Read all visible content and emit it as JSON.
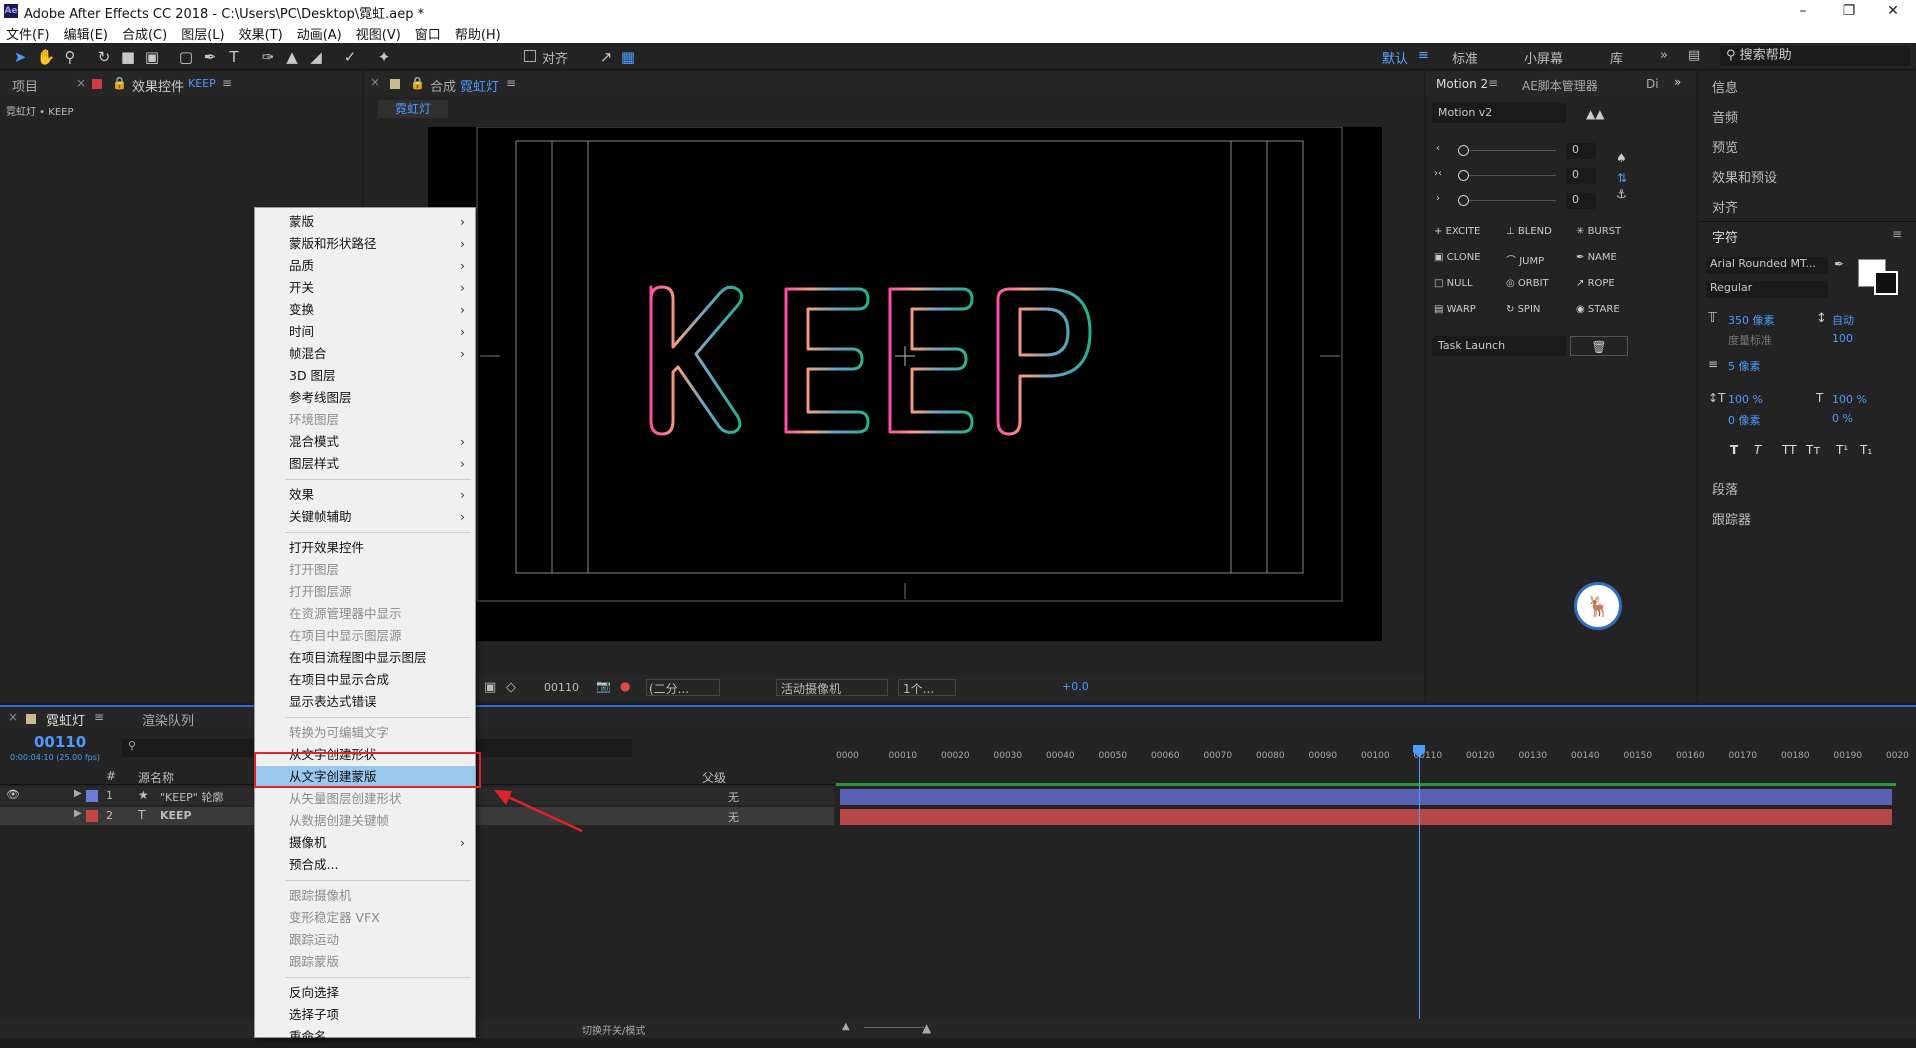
{
  "title": {
    "app_icon": "Ae",
    "text": "Adobe After Effects CC 2018 - C:\\Users\\PC\\Desktop\\霓虹.aep *"
  },
  "menu": [
    "文件(F)",
    "编辑(E)",
    "合成(C)",
    "图层(L)",
    "效果(T)",
    "动画(A)",
    "视图(V)",
    "窗口",
    "帮助(H)"
  ],
  "toolbar": {
    "snap_label": "对齐",
    "workspaces": [
      "默认",
      "标准",
      "小屏幕",
      "库"
    ],
    "search_placeholder": "搜索帮助",
    "more": "»"
  },
  "left_panel": {
    "tab_project": "项目",
    "tab_effects": "效果控件",
    "tab_effects_layer": "KEEP",
    "breadcrumb": "霓虹灯 • KEEP"
  },
  "comp_panel": {
    "tab_prefix": "合成",
    "tab_name": "霓虹灯",
    "subtab": "霓虹灯",
    "neon_text": [
      "K",
      "E",
      "E",
      "P"
    ],
    "timecode": "00110",
    "resolution": "(二分...",
    "camera": "活动摄像机",
    "views": "1个...",
    "exposure": "+0.0"
  },
  "motion_panel": {
    "tab": "Motion 2",
    "tab2": "AE脚本管理器",
    "tab3": "Di",
    "preset": "Motion v2",
    "slider_values": [
      "0",
      "0",
      "0"
    ],
    "buttons": [
      "EXCITE",
      "BLEND",
      "BURST",
      "CLONE",
      "JUMP",
      "NAME",
      "NULL",
      "ORBIT",
      "ROPE",
      "WARP",
      "SPIN",
      "STARE"
    ],
    "launch": "Task Launch"
  },
  "right_panel": {
    "items_top": [
      "信息",
      "音频",
      "预览",
      "效果和预设",
      "对齐"
    ],
    "char_title": "字符",
    "font": "Arial Rounded MT...",
    "style": "Regular",
    "size": "350 像素",
    "leading": "自动",
    "kerning": "度量标准",
    "tracking": "100",
    "stroke": "5 像素",
    "vscale": "100 %",
    "hscale": "100 %",
    "baseline": "0 像素",
    "tsume": "0 %",
    "style_buttons": [
      "T",
      "T",
      "TT",
      "Tт",
      "T¹",
      "T₁"
    ],
    "items_bottom": [
      "段落",
      "跟踪器"
    ]
  },
  "timeline": {
    "tab": "霓虹灯",
    "tab2": "渲染队列",
    "timecode": "00110",
    "fps": "0:00:04:10 (25.00 fps)",
    "col_name": "源名称",
    "col_parent": "父级",
    "col_num": "#",
    "layers": [
      {
        "num": "1",
        "icon": "★",
        "name": "\"KEEP\" 轮廓",
        "color": "#6f79d9",
        "parent": "无"
      },
      {
        "num": "2",
        "icon": "T",
        "name": "KEEP",
        "color": "#c64545",
        "parent": "无"
      }
    ],
    "ruler": [
      "0000",
      "00010",
      "00020",
      "00030",
      "00040",
      "00050",
      "00060",
      "00070",
      "00080",
      "00090",
      "00100",
      "00110",
      "00120",
      "00130",
      "00140",
      "00150",
      "00160",
      "00170",
      "00180",
      "00190",
      "0020"
    ],
    "bottom": "切换开关/模式"
  },
  "context_menu": [
    {
      "label": "蒙版",
      "sub": true
    },
    {
      "label": "蒙版和形状路径",
      "sub": true
    },
    {
      "label": "品质",
      "sub": true
    },
    {
      "label": "开关",
      "sub": true
    },
    {
      "label": "变换",
      "sub": true
    },
    {
      "label": "时间",
      "sub": true
    },
    {
      "label": "帧混合",
      "sub": true
    },
    {
      "label": "3D 图层"
    },
    {
      "label": "参考线图层"
    },
    {
      "label": "环境图层",
      "dis": true
    },
    {
      "label": "混合模式",
      "sub": true
    },
    {
      "label": "图层样式",
      "sub": true
    },
    {
      "sep": true
    },
    {
      "label": "效果",
      "sub": true
    },
    {
      "label": "关键帧辅助",
      "sub": true
    },
    {
      "sep": true
    },
    {
      "label": "打开效果控件"
    },
    {
      "label": "打开图层",
      "dis": true
    },
    {
      "label": "打开图层源",
      "dis": true
    },
    {
      "label": "在资源管理器中显示",
      "dis": true
    },
    {
      "label": "在项目中显示图层源",
      "dis": true
    },
    {
      "label": "在项目流程图中显示图层"
    },
    {
      "label": "在项目中显示合成"
    },
    {
      "label": "显示表达式错误"
    },
    {
      "sep": true
    },
    {
      "label": "转换为可编辑文字",
      "dis": true
    },
    {
      "label": "从文字创建形状"
    },
    {
      "label": "从文字创建蒙版",
      "hl": true
    },
    {
      "label": "从矢量图层创建形状",
      "dis": true
    },
    {
      "label": "从数据创建关键帧",
      "dis": true
    },
    {
      "label": "摄像机",
      "sub": true
    },
    {
      "label": "预合成..."
    },
    {
      "sep": true
    },
    {
      "label": "跟踪摄像机",
      "dis": true
    },
    {
      "label": "变形稳定器 VFX",
      "dis": true
    },
    {
      "label": "跟踪运动",
      "dis": true
    },
    {
      "label": "跟踪蒙版",
      "dis": true
    },
    {
      "sep": true
    },
    {
      "label": "反向选择"
    },
    {
      "label": "选择子项"
    },
    {
      "label": "重命名"
    }
  ],
  "colors": {
    "accent": "#4d9bff",
    "highlight": "#99c9ef",
    "annotation": "#e0232a"
  }
}
